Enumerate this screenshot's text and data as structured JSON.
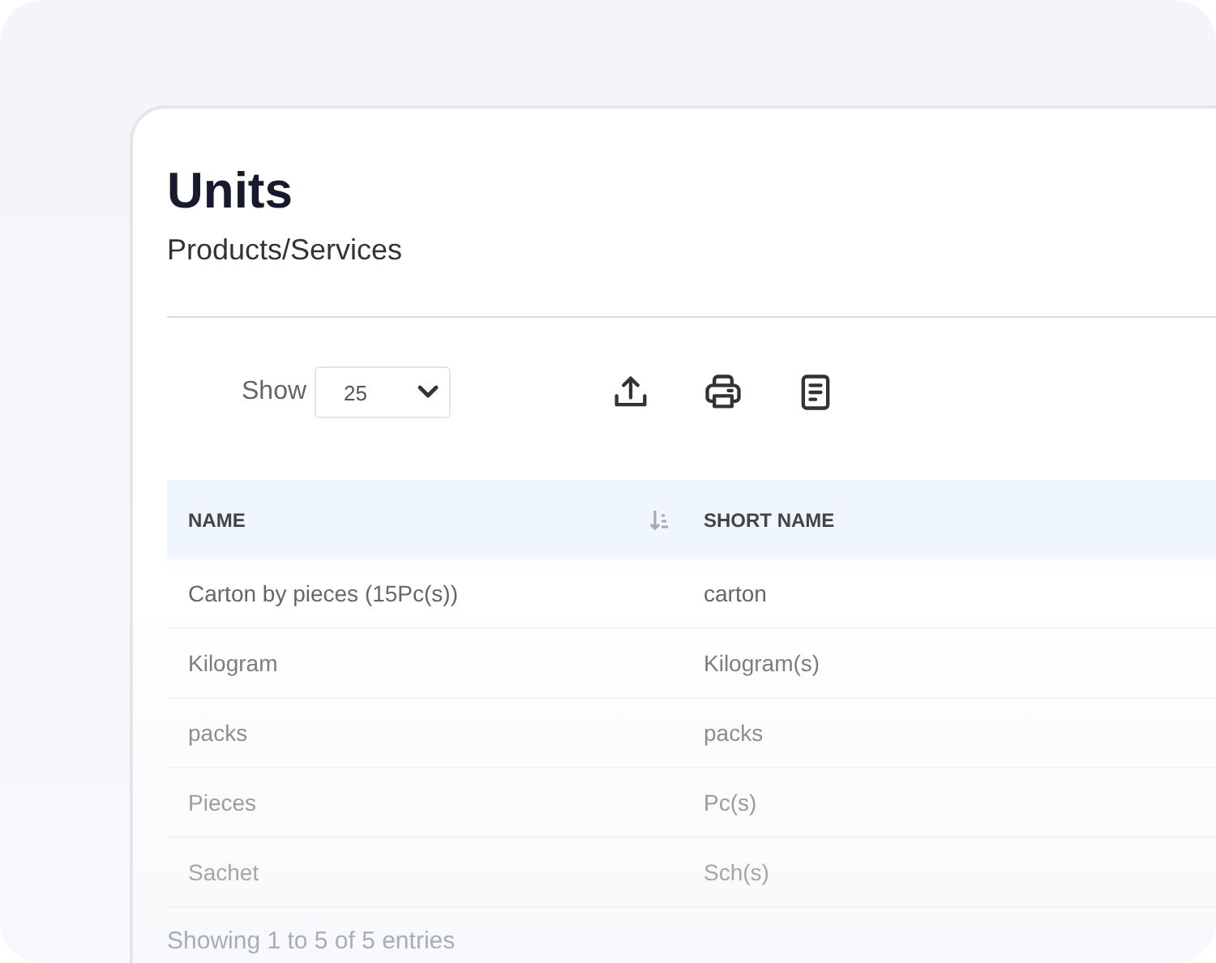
{
  "page": {
    "title": "Units",
    "subtitle": "Products/Services"
  },
  "toolbar": {
    "show_label": "Show",
    "page_size": "25"
  },
  "table": {
    "columns": [
      {
        "label": "NAME",
        "sortable": true
      },
      {
        "label": "SHORT NAME",
        "sortable": false
      }
    ],
    "rows": [
      [
        "Carton by pieces (15Pc(s))",
        "carton"
      ],
      [
        "Kilogram",
        "Kilogram(s)"
      ],
      [
        "packs",
        "packs"
      ],
      [
        "Pieces",
        "Pc(s)"
      ],
      [
        "Sachet",
        "Sch(s)"
      ]
    ]
  },
  "footer": {
    "summary": "Showing 1 to 5 of 5 entries"
  }
}
